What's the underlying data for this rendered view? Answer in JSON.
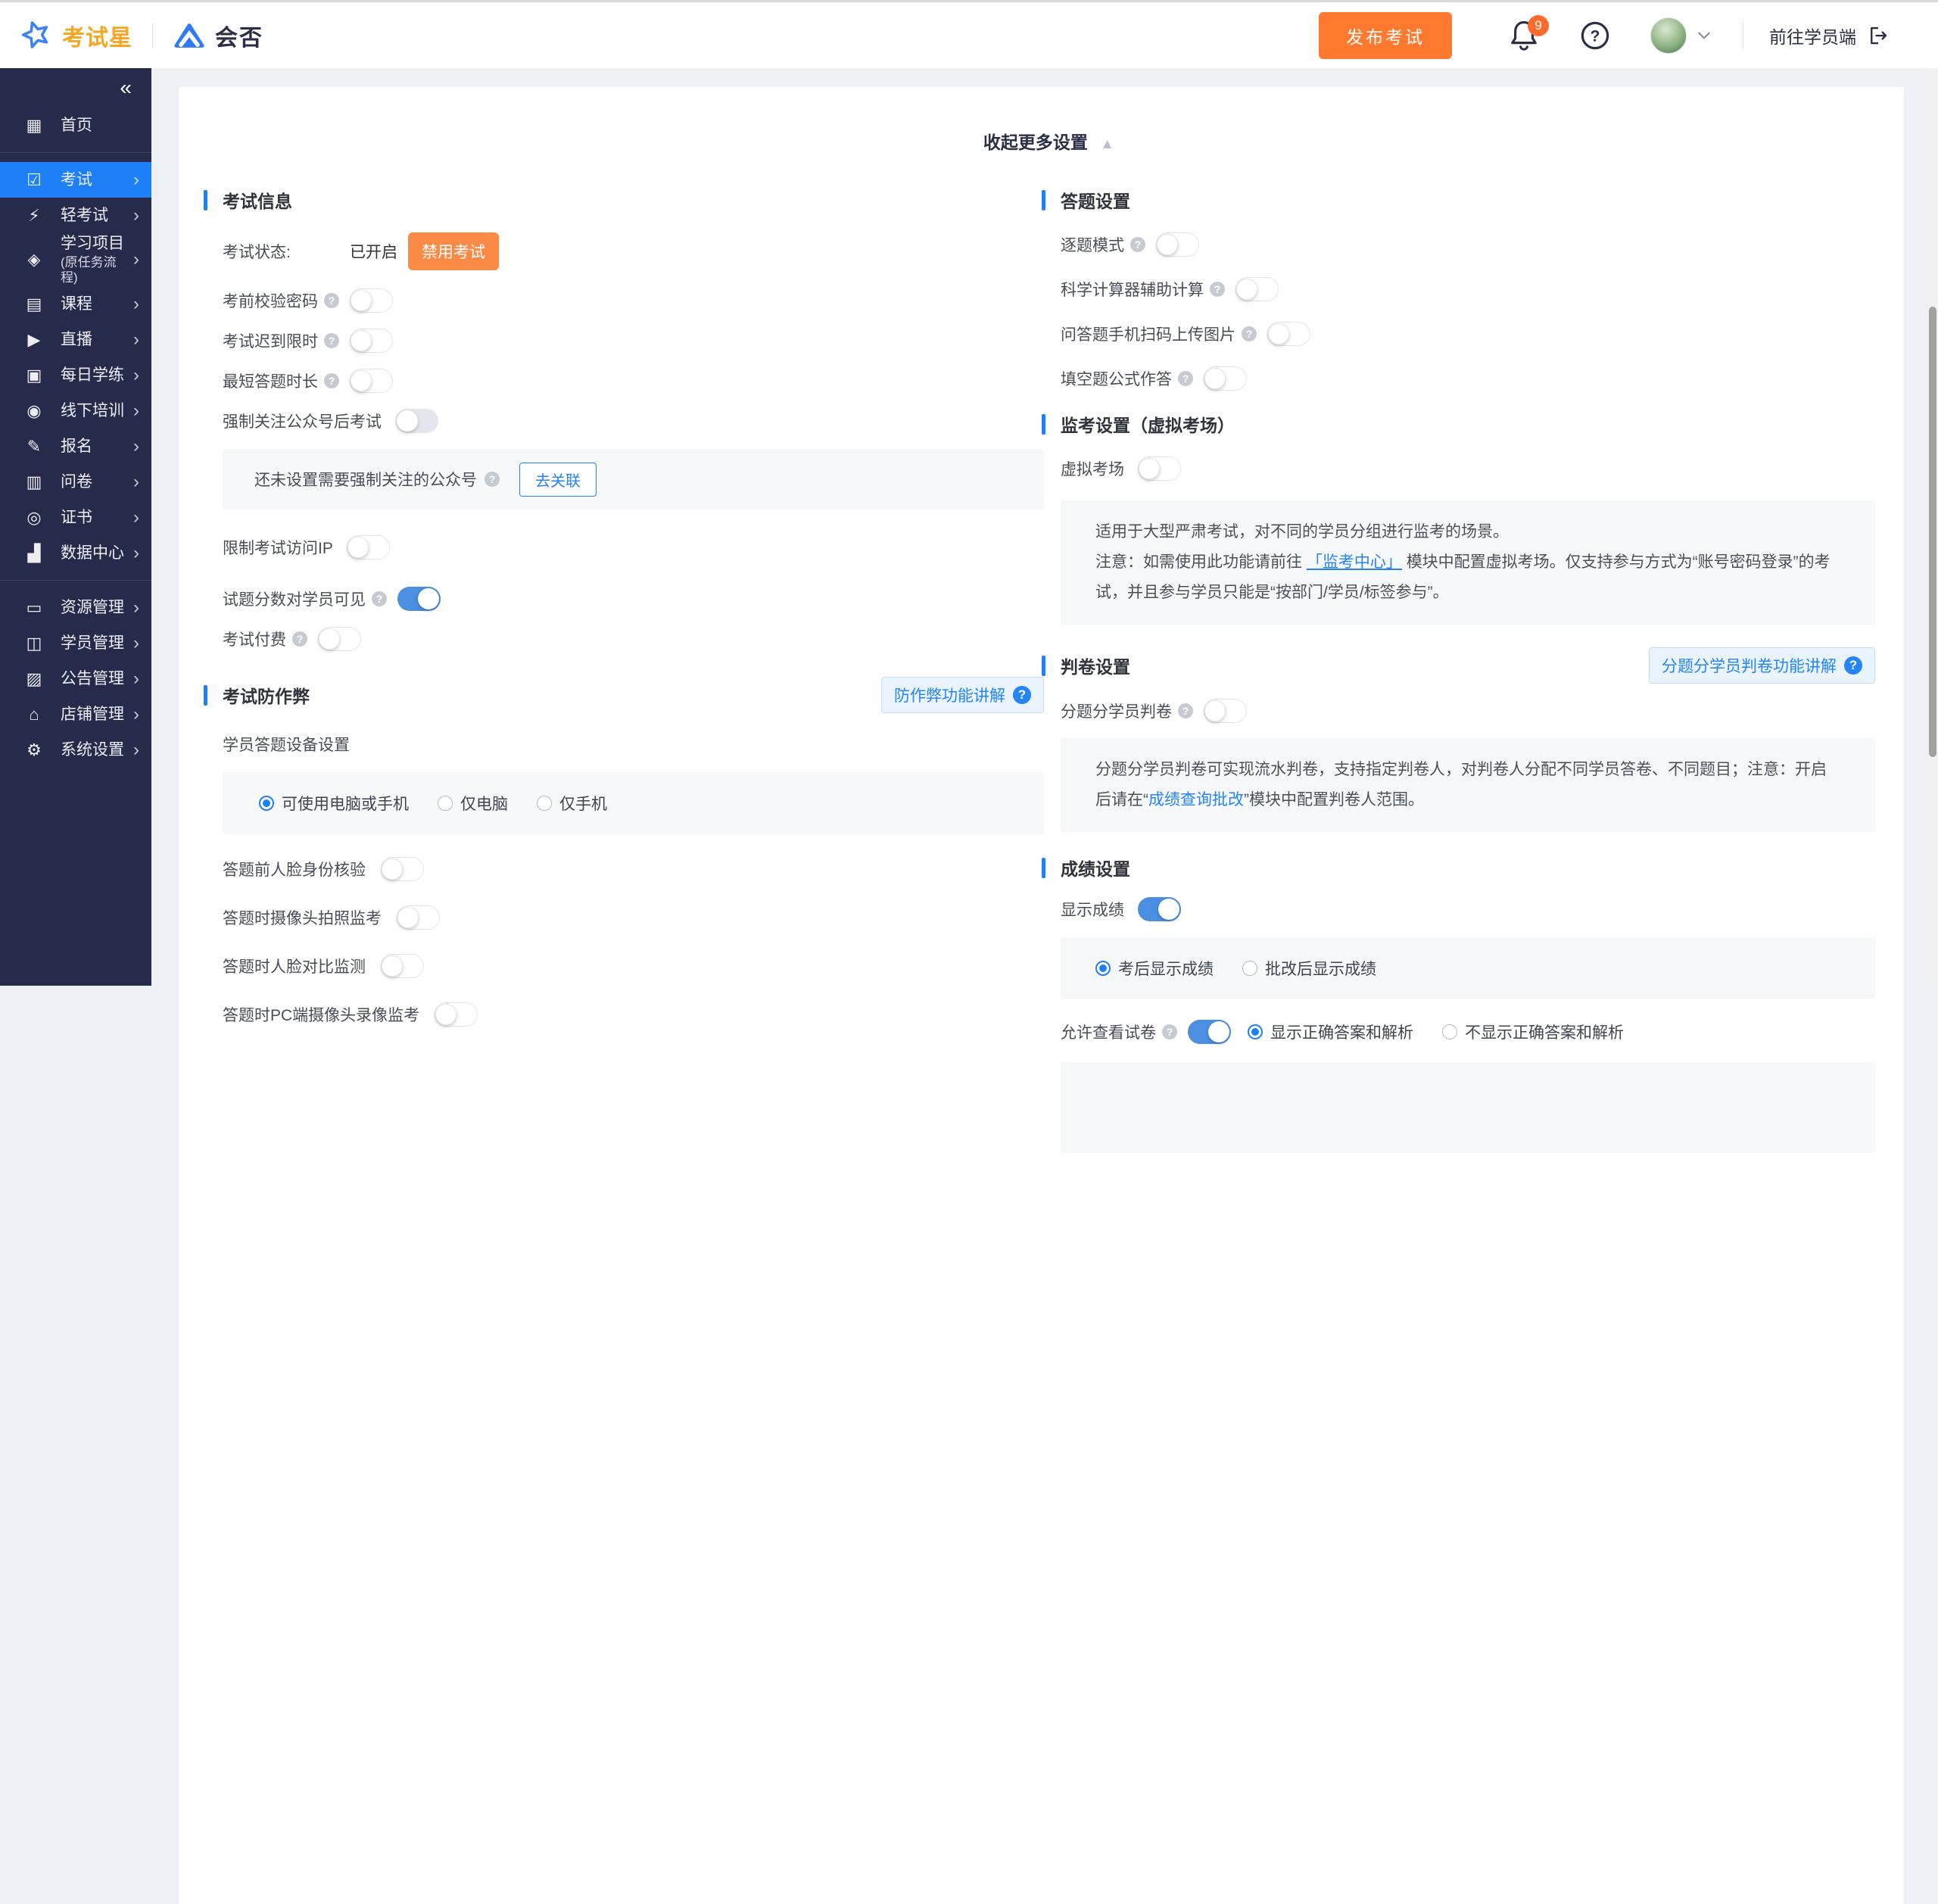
{
  "colors": {
    "accent": "#1E80F8",
    "orange": "#FF7A2E",
    "toggle_on": "#4A8FE2",
    "badge_orange": "#FC8A47"
  },
  "header": {
    "brand": "考试星",
    "brand2": "会否",
    "publish_label": "发布考试",
    "notification_count": "9",
    "portal_label": "前往学员端"
  },
  "sidebar": {
    "collapse_icon": "«",
    "items": [
      {
        "label": "首页",
        "icon": "grid-icon"
      },
      {
        "label": "考试",
        "icon": "exam-icon",
        "active": true
      },
      {
        "label": "轻考试",
        "icon": "light-exam-icon"
      },
      {
        "label": "学习项目",
        "sub": "(原任务流程)",
        "icon": "project-icon"
      },
      {
        "label": "课程",
        "icon": "course-icon"
      },
      {
        "label": "直播",
        "icon": "live-icon"
      },
      {
        "label": "每日学练",
        "icon": "daily-practice-icon"
      },
      {
        "label": "线下培训",
        "icon": "offline-training-icon"
      },
      {
        "label": "报名",
        "icon": "signup-icon"
      },
      {
        "label": "问卷",
        "icon": "survey-icon"
      },
      {
        "label": "证书",
        "icon": "certificate-icon"
      },
      {
        "label": "数据中心",
        "icon": "data-center-icon"
      },
      {
        "label": "资源管理",
        "icon": "resource-icon"
      },
      {
        "label": "学员管理",
        "icon": "student-icon"
      },
      {
        "label": "公告管理",
        "icon": "announcement-icon"
      },
      {
        "label": "店铺管理",
        "icon": "shop-icon"
      },
      {
        "label": "系统设置",
        "icon": "settings-icon"
      }
    ]
  },
  "main": {
    "collapse_title": "收起更多设置",
    "exam_info": {
      "title": "考试信息",
      "status_label": "考试状态:",
      "status_value": "已开启",
      "disable_button": "禁用考试",
      "toggles": [
        {
          "label": "考前校验密码"
        },
        {
          "label": "考试迟到限时"
        },
        {
          "label": "最短答题时长"
        },
        {
          "label": "强制关注公众号后考试"
        }
      ],
      "wechat_notice": "还未设置需要强制关注的公众号",
      "wechat_button": "去关联",
      "toggles2": [
        {
          "label": "限制考试访问IP"
        },
        {
          "label": "试题分数对学员可见"
        },
        {
          "label": "考试付费"
        }
      ]
    },
    "anti_cheat": {
      "title": "考试防作弊",
      "helper_button": "防作弊功能讲解",
      "device_label": "学员答题设备设置",
      "device_options": [
        {
          "label": "可使用电脑或手机",
          "selected": true
        },
        {
          "label": "仅电脑",
          "selected": false
        },
        {
          "label": "仅手机",
          "selected": false
        }
      ],
      "toggles": [
        {
          "label": "答题前人脸身份核验"
        },
        {
          "label": "答题时摄像头拍照监考"
        },
        {
          "label": "答题时人脸对比监测"
        },
        {
          "label": "答题时PC端摄像头录像监考"
        }
      ]
    },
    "answer_settings": {
      "title": "答题设置",
      "toggles": [
        {
          "label": "逐题模式"
        },
        {
          "label": "科学计算器辅助计算"
        },
        {
          "label": "问答题手机扫码上传图片"
        },
        {
          "label": "填空题公式作答"
        }
      ]
    },
    "proctor": {
      "title": "监考设置（虚拟考场）",
      "toggle_label": "虚拟考场",
      "notice_line1": "适用于大型严肃考试，对不同的学员分组进行监考的场景。",
      "notice_line2_pre": "注意：如需使用此功能请前往",
      "notice_link": "「监考中心」",
      "notice_line2_post": "模块中配置虚拟考场。仅支持参与方式为“账号密码登录”的考试，并且参与学员只能是“按部门/学员/标签参与”。"
    },
    "grading": {
      "title": "判卷设置",
      "helper_button": "分题分学员判卷功能讲解",
      "toggle_label": "分题分学员判卷",
      "notice_pre": "分题分学员判卷可实现流水判卷，支持指定判卷人，对判卷人分配不同学员答卷、不同题目；注意：开启后请在“",
      "notice_link": "成绩查询批改",
      "notice_post": "”模块中配置判卷人范围。"
    },
    "score": {
      "title": "成绩设置",
      "show_score_label": "显示成绩",
      "score_options": [
        {
          "label": "考后显示成绩",
          "selected": true
        },
        {
          "label": "批改后显示成绩",
          "selected": false
        }
      ],
      "review_label": "允许查看试卷",
      "review_options": [
        {
          "label": "显示正确答案和解析",
          "selected": true
        },
        {
          "label": "不显示正确答案和解析",
          "selected": false
        }
      ]
    }
  }
}
